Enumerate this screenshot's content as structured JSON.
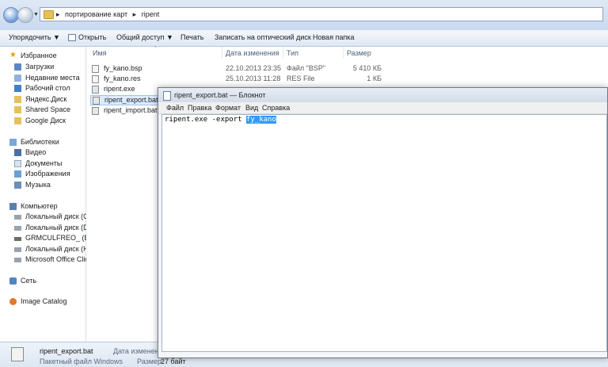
{
  "address": {
    "crumbs": [
      "портирование карт",
      "ripent"
    ],
    "sep": "▸"
  },
  "toolbar": {
    "organize": "Упорядочить ▼",
    "open": "Открыть",
    "share": "Общий доступ ▼",
    "print": "Печать",
    "burn": "Записать на оптический диск",
    "new_folder": "Новая папка"
  },
  "nav": {
    "favorites": "Избранное",
    "downloads": "Загрузки",
    "recent": "Недавние места",
    "desktop": "Рабочий стол",
    "yandex": "Яндекс.Диск",
    "shared": "Shared Space",
    "gdrive": "Google Диск",
    "libraries": "Библиотеки",
    "video": "Видео",
    "docs": "Документы",
    "images": "Изображения",
    "music": "Музыка",
    "computer": "Компьютер",
    "disk_c": "Локальный диск (C:)",
    "disk_d": "Локальный диск (D:)",
    "disk_e": "GRMCULFREO_ (E:)",
    "disk_h": "Локальный диск (H:)",
    "office": "Microsoft Office Click",
    "network": "Сеть",
    "image_catalog": "Image Catalog"
  },
  "columns": {
    "name": "Имя",
    "date": "Дата изменения",
    "type": "Тип",
    "size": "Размер"
  },
  "files": [
    {
      "name": "fy_kano.bsp",
      "date": "22.10.2013 23:35",
      "type": "Файл \"BSP\"",
      "size": "5 410 КБ"
    },
    {
      "name": "fy_kano.res",
      "date": "25.10.2013 11:28",
      "type": "RES File",
      "size": "1 КБ"
    },
    {
      "name": "ripent.exe",
      "date": "",
      "type": "",
      "size": ""
    },
    {
      "name": "ripent_export.bat",
      "date": "",
      "type": "",
      "size": ""
    },
    {
      "name": "ripent_import.bat",
      "date": "",
      "type": "",
      "size": ""
    }
  ],
  "details": {
    "name": "ripent_export.bat",
    "kind": "Пакетный файл Windows",
    "date_label": "Дата изменени",
    "size_label": "Размер:",
    "size_value": "27 байт"
  },
  "notepad": {
    "title": "ripent_export.bat — Блокнот",
    "menu": [
      "Файл",
      "Правка",
      "Формат",
      "Вид",
      "Справка"
    ],
    "text_before": "ripent.exe -export ",
    "text_selected": "fy_kano"
  }
}
